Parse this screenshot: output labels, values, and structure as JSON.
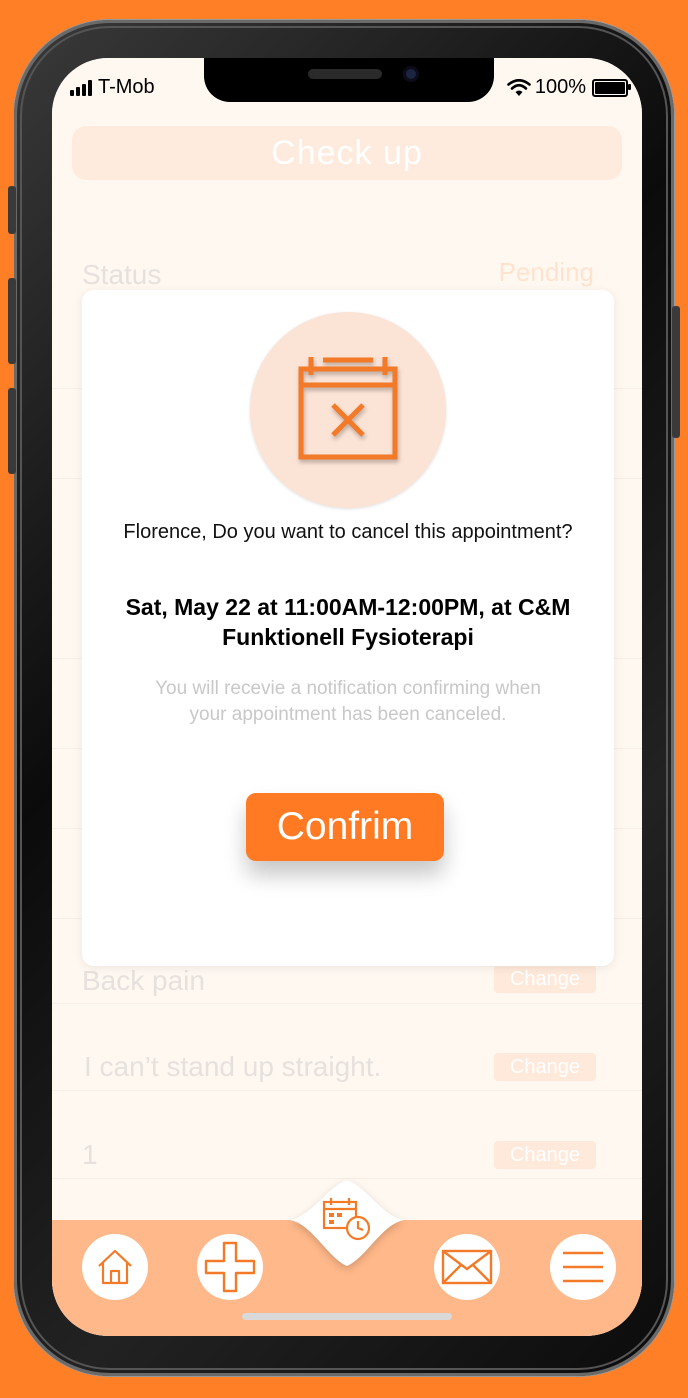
{
  "status_bar": {
    "carrier": "T-Mob",
    "battery": "100%"
  },
  "background_screen": {
    "title": "Check up",
    "status_label": "Status",
    "status_value": "Pending",
    "rows": [
      {
        "value": "Back pain",
        "action": "Change"
      },
      {
        "value": "I can’t stand up straight.",
        "action": "Change"
      },
      {
        "value": "1",
        "action": "Change"
      }
    ]
  },
  "modal": {
    "icon": "calendar-cancel-icon",
    "question": "Florence, Do you want to cancel this appointment?",
    "details": "Sat, May 22 at 11:00AM-12:00PM, at C&M Funktionell Fysioterapi",
    "note": "You will recevie a notification confirming when your appointment has been canceled.",
    "confirm_label": "Confrim"
  },
  "nav": {
    "items": [
      {
        "icon": "home-icon"
      },
      {
        "icon": "plus-icon"
      },
      {
        "icon": "calendar-clock-icon"
      },
      {
        "icon": "mail-icon"
      },
      {
        "icon": "menu-icon"
      }
    ]
  },
  "colors": {
    "accent": "#FF7A22",
    "page_background": "#FF7F27",
    "nav_background": "#FFB889",
    "icon_circle": "#FBE3D6",
    "faded_text": "#E6E1DD"
  }
}
